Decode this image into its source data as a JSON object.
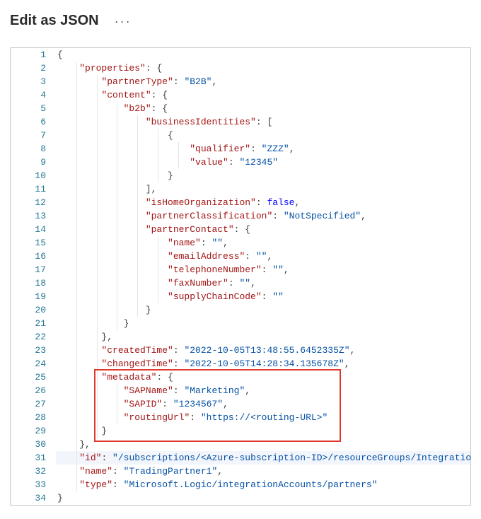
{
  "header": {
    "title": "Edit as JSON",
    "more_label": "···"
  },
  "highlight": {
    "fromLine": 25,
    "toLine": 29
  },
  "code": {
    "indentSize": 4,
    "lines": [
      {
        "n": 1,
        "indent": 0,
        "tokens": [
          [
            "brace",
            "{"
          ]
        ]
      },
      {
        "n": 2,
        "indent": 1,
        "tokens": [
          [
            "key",
            "\"properties\""
          ],
          [
            "colon",
            ": "
          ],
          [
            "brace",
            "{"
          ]
        ]
      },
      {
        "n": 3,
        "indent": 2,
        "tokens": [
          [
            "key",
            "\"partnerType\""
          ],
          [
            "colon",
            ": "
          ],
          [
            "string",
            "\"B2B\""
          ],
          [
            "comma",
            ","
          ]
        ]
      },
      {
        "n": 4,
        "indent": 2,
        "tokens": [
          [
            "key",
            "\"content\""
          ],
          [
            "colon",
            ": "
          ],
          [
            "brace",
            "{"
          ]
        ]
      },
      {
        "n": 5,
        "indent": 3,
        "tokens": [
          [
            "key",
            "\"b2b\""
          ],
          [
            "colon",
            ": "
          ],
          [
            "brace",
            "{"
          ]
        ]
      },
      {
        "n": 6,
        "indent": 4,
        "tokens": [
          [
            "key",
            "\"businessIdentities\""
          ],
          [
            "colon",
            ": "
          ],
          [
            "brace",
            "["
          ]
        ]
      },
      {
        "n": 7,
        "indent": 5,
        "tokens": [
          [
            "brace",
            "{"
          ]
        ]
      },
      {
        "n": 8,
        "indent": 6,
        "tokens": [
          [
            "key",
            "\"qualifier\""
          ],
          [
            "colon",
            ": "
          ],
          [
            "string",
            "\"ZZZ\""
          ],
          [
            "comma",
            ","
          ]
        ]
      },
      {
        "n": 9,
        "indent": 6,
        "tokens": [
          [
            "key",
            "\"value\""
          ],
          [
            "colon",
            ": "
          ],
          [
            "string",
            "\"12345\""
          ]
        ]
      },
      {
        "n": 10,
        "indent": 5,
        "tokens": [
          [
            "brace",
            "}"
          ]
        ]
      },
      {
        "n": 11,
        "indent": 4,
        "tokens": [
          [
            "brace",
            "]"
          ],
          [
            "comma",
            ","
          ]
        ]
      },
      {
        "n": 12,
        "indent": 4,
        "tokens": [
          [
            "key",
            "\"isHomeOrganization\""
          ],
          [
            "colon",
            ": "
          ],
          [
            "bool",
            "false"
          ],
          [
            "comma",
            ","
          ]
        ]
      },
      {
        "n": 13,
        "indent": 4,
        "tokens": [
          [
            "key",
            "\"partnerClassification\""
          ],
          [
            "colon",
            ": "
          ],
          [
            "string",
            "\"NotSpecified\""
          ],
          [
            "comma",
            ","
          ]
        ]
      },
      {
        "n": 14,
        "indent": 4,
        "tokens": [
          [
            "key",
            "\"partnerContact\""
          ],
          [
            "colon",
            ": "
          ],
          [
            "brace",
            "{"
          ]
        ]
      },
      {
        "n": 15,
        "indent": 5,
        "tokens": [
          [
            "key",
            "\"name\""
          ],
          [
            "colon",
            ": "
          ],
          [
            "string",
            "\"\""
          ],
          [
            "comma",
            ","
          ]
        ]
      },
      {
        "n": 16,
        "indent": 5,
        "tokens": [
          [
            "key",
            "\"emailAddress\""
          ],
          [
            "colon",
            ": "
          ],
          [
            "string",
            "\"\""
          ],
          [
            "comma",
            ","
          ]
        ]
      },
      {
        "n": 17,
        "indent": 5,
        "tokens": [
          [
            "key",
            "\"telephoneNumber\""
          ],
          [
            "colon",
            ": "
          ],
          [
            "string",
            "\"\""
          ],
          [
            "comma",
            ","
          ]
        ]
      },
      {
        "n": 18,
        "indent": 5,
        "tokens": [
          [
            "key",
            "\"faxNumber\""
          ],
          [
            "colon",
            ": "
          ],
          [
            "string",
            "\"\""
          ],
          [
            "comma",
            ","
          ]
        ]
      },
      {
        "n": 19,
        "indent": 5,
        "tokens": [
          [
            "key",
            "\"supplyChainCode\""
          ],
          [
            "colon",
            ": "
          ],
          [
            "string",
            "\"\""
          ]
        ]
      },
      {
        "n": 20,
        "indent": 4,
        "tokens": [
          [
            "brace",
            "}"
          ]
        ]
      },
      {
        "n": 21,
        "indent": 3,
        "tokens": [
          [
            "brace",
            "}"
          ]
        ]
      },
      {
        "n": 22,
        "indent": 2,
        "tokens": [
          [
            "brace",
            "}"
          ],
          [
            "comma",
            ","
          ]
        ]
      },
      {
        "n": 23,
        "indent": 2,
        "tokens": [
          [
            "key",
            "\"createdTime\""
          ],
          [
            "colon",
            ": "
          ],
          [
            "string",
            "\"2022-10-05T13:48:55.6452335Z\""
          ],
          [
            "comma",
            ","
          ]
        ]
      },
      {
        "n": 24,
        "indent": 2,
        "tokens": [
          [
            "key",
            "\"changedTime\""
          ],
          [
            "colon",
            ": "
          ],
          [
            "string",
            "\"2022-10-05T14:28:34.135678Z\""
          ],
          [
            "comma",
            ","
          ]
        ]
      },
      {
        "n": 25,
        "indent": 2,
        "tokens": [
          [
            "key",
            "\"metadata\""
          ],
          [
            "colon",
            ": "
          ],
          [
            "brace",
            "{"
          ]
        ]
      },
      {
        "n": 26,
        "indent": 3,
        "tokens": [
          [
            "key",
            "\"SAPName\""
          ],
          [
            "colon",
            ": "
          ],
          [
            "string",
            "\"Marketing\""
          ],
          [
            "comma",
            ","
          ]
        ]
      },
      {
        "n": 27,
        "indent": 3,
        "tokens": [
          [
            "key",
            "\"SAPID\""
          ],
          [
            "colon",
            ": "
          ],
          [
            "string",
            "\"1234567\""
          ],
          [
            "comma",
            ","
          ]
        ]
      },
      {
        "n": 28,
        "indent": 3,
        "tokens": [
          [
            "key",
            "\"routingUrl\""
          ],
          [
            "colon",
            ": "
          ],
          [
            "string",
            "\"https://<routing-URL>\""
          ]
        ]
      },
      {
        "n": 29,
        "indent": 2,
        "tokens": [
          [
            "brace",
            "}"
          ]
        ]
      },
      {
        "n": 30,
        "indent": 1,
        "tokens": [
          [
            "brace",
            "}"
          ],
          [
            "comma",
            ","
          ]
        ]
      },
      {
        "n": 31,
        "indent": 1,
        "current": true,
        "tokens": [
          [
            "key",
            "\"id\""
          ],
          [
            "colon",
            ": "
          ],
          [
            "string",
            "\"/subscriptions/<Azure-subscription-ID>/resourceGroups/Integration-a"
          ]
        ]
      },
      {
        "n": 32,
        "indent": 1,
        "tokens": [
          [
            "key",
            "\"name\""
          ],
          [
            "colon",
            ": "
          ],
          [
            "string",
            "\"TradingPartner1\""
          ],
          [
            "comma",
            ","
          ]
        ]
      },
      {
        "n": 33,
        "indent": 1,
        "tokens": [
          [
            "key",
            "\"type\""
          ],
          [
            "colon",
            ": "
          ],
          [
            "string",
            "\"Microsoft.Logic/integrationAccounts/partners\""
          ]
        ]
      },
      {
        "n": 34,
        "indent": 0,
        "tokens": [
          [
            "brace",
            "}"
          ]
        ]
      }
    ]
  }
}
